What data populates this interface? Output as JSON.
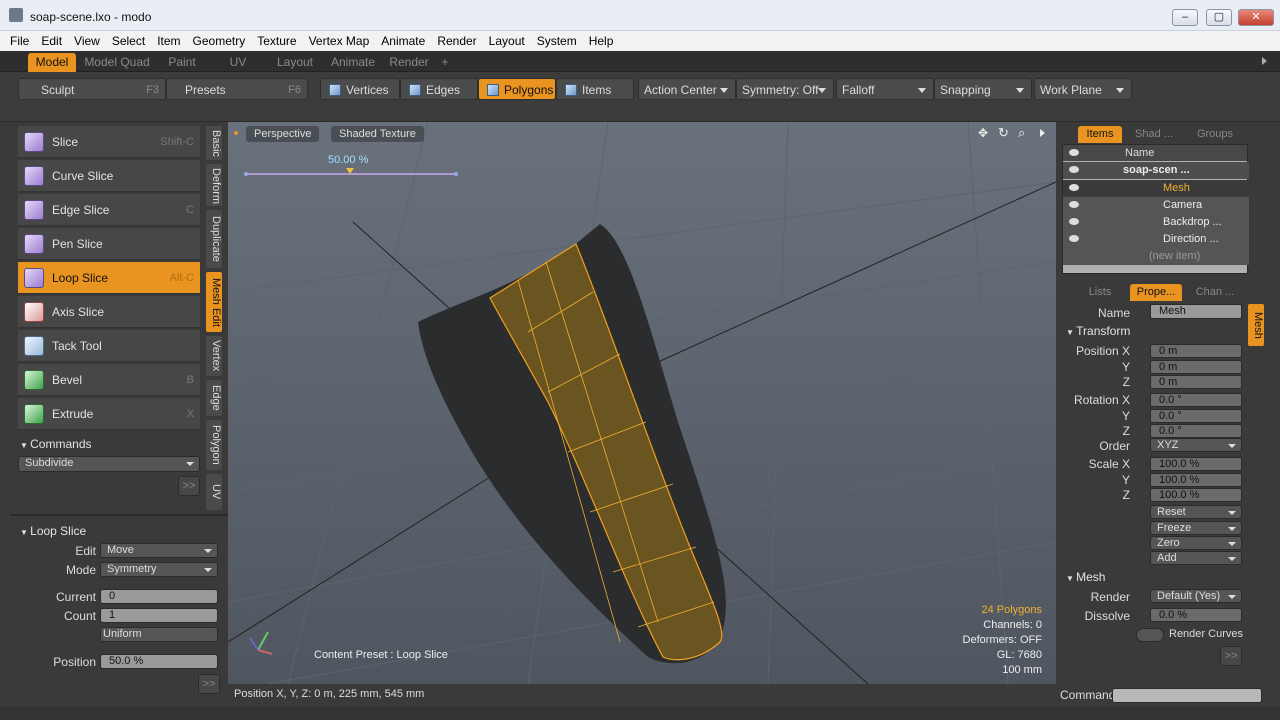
{
  "window": {
    "title": "soap-scene.lxo - modo",
    "min": "–",
    "max": "▢",
    "close": "✕"
  },
  "menu": [
    "File",
    "Edit",
    "View",
    "Select",
    "Item",
    "Geometry",
    "Texture",
    "Vertex Map",
    "Animate",
    "Render",
    "Layout",
    "System",
    "Help"
  ],
  "mode_tabs": [
    "Model",
    "Model Quad",
    "Paint",
    "UV",
    "Layout",
    "Animate",
    "Render",
    "+"
  ],
  "toolbar": {
    "sculpt": {
      "label": "Sculpt",
      "key": "F3"
    },
    "presets": {
      "label": "Presets",
      "key": "F6"
    },
    "vertices": "Vertices",
    "edges": "Edges",
    "polygons": "Polygons",
    "items": "Items",
    "action_center": "Action Center",
    "symmetry": "Symmetry: Off",
    "falloff": "Falloff",
    "snapping": "Snapping",
    "work_plane": "Work Plane"
  },
  "tools": [
    {
      "label": "Slice",
      "key": "Shift-C"
    },
    {
      "label": "Curve Slice",
      "key": ""
    },
    {
      "label": "Edge Slice",
      "key": "C"
    },
    {
      "label": "Pen Slice",
      "key": ""
    },
    {
      "label": "Loop Slice",
      "key": "Alt-C"
    },
    {
      "label": "Axis Slice",
      "key": ""
    },
    {
      "label": "Tack Tool",
      "key": ""
    },
    {
      "label": "Bevel",
      "key": "B"
    },
    {
      "label": "Extrude",
      "key": "X"
    }
  ],
  "vtabs": [
    "Basic",
    "Deform",
    "Duplicate",
    "Mesh Edit",
    "Vertex",
    "Edge",
    "Polygon",
    "UV"
  ],
  "commands": {
    "header": "Commands",
    "select": "Subdivide",
    "more": ">>"
  },
  "loop_slice": {
    "header": "Loop Slice",
    "edit_label": "Edit",
    "edit_value": "Move",
    "mode_label": "Mode",
    "mode_value": "Symmetry",
    "current_label": "Current",
    "current_value": "0",
    "count_label": "Count",
    "count_value": "1",
    "uniform": "Uniform",
    "position_label": "Position",
    "position_value": "50.0 %",
    "more": ">>"
  },
  "viewport": {
    "view": "Perspective",
    "shading": "Shaded Texture",
    "slider_value": "50.00 %",
    "content_preset": "Content Preset : Loop Slice",
    "hud": [
      "24 Polygons",
      "Channels: 0",
      "Deformers: OFF",
      "GL: 7680",
      "100 mm"
    ]
  },
  "status": "Position X, Y, Z:   0 m, 225 mm, 545 mm",
  "items_panel": {
    "tabs": [
      "Items",
      "Shad ...",
      "Groups"
    ],
    "name_header": "Name",
    "rows": [
      "soap-scen ...",
      "Mesh",
      "Camera",
      "Backdrop ...",
      "Direction ...",
      "(new item)"
    ]
  },
  "props_panel": {
    "tabs": [
      "Lists",
      "Prope...",
      "Chan ..."
    ],
    "side_tab": "Mesh",
    "name_label": "Name",
    "name_value": "Mesh",
    "transform": "Transform",
    "position_label": "Position X",
    "px": "0 m",
    "py": "0 m",
    "pz": "0 m",
    "rotation_label": "Rotation X",
    "rx": "0.0 °",
    "ry": "0.0 °",
    "rz": "0.0 °",
    "order_label": "Order",
    "order_value": "XYZ",
    "scale_label": "Scale X",
    "sx": "100.0 %",
    "sy": "100.0 %",
    "sz": "100.0 %",
    "y": "Y",
    "z": "Z",
    "reset": "Reset",
    "freeze": "Freeze",
    "zero": "Zero",
    "add": "Add",
    "mesh_section": "Mesh",
    "render_label": "Render",
    "render_value": "Default (Yes)",
    "dissolve_label": "Dissolve",
    "dissolve_value": "0.0 %",
    "render_curves": "Render Curves",
    "more": ">>"
  },
  "command_label": "Command"
}
